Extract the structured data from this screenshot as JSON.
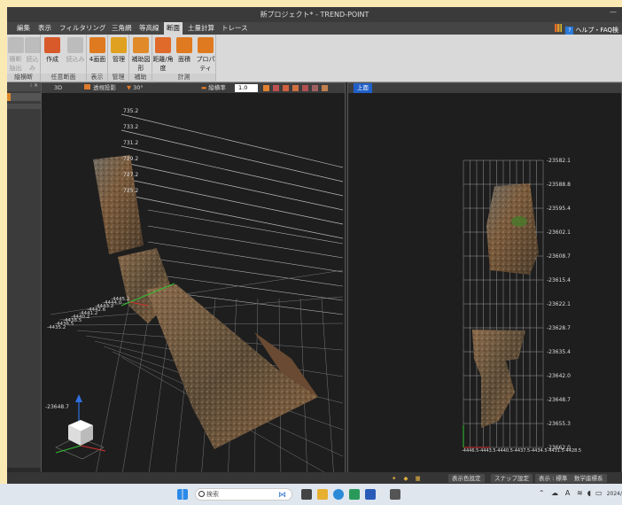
{
  "window": {
    "title": "新プロジェクト* - TREND-POINT"
  },
  "menu": {
    "tabs": [
      "編集",
      "表示",
      "フィルタリング",
      "三角網",
      "等高線",
      "断面",
      "土量計算",
      "トレース"
    ],
    "active": "断面",
    "help_label": "ヘルプ・FAQ検"
  },
  "ribbon": {
    "groups": [
      {
        "label": "縦横断",
        "buttons": [
          {
            "label": "横断抽出",
            "disabled": true
          },
          {
            "label": "読込み",
            "disabled": true
          }
        ]
      },
      {
        "label": "任意断面",
        "buttons": [
          {
            "label": "作成",
            "disabled": false
          },
          {
            "label": "読込み",
            "disabled": true
          }
        ]
      },
      {
        "label": "表示",
        "buttons": [
          {
            "label": "4画面",
            "disabled": false
          }
        ]
      },
      {
        "label": "管理",
        "buttons": [
          {
            "label": "管理",
            "disabled": false
          }
        ]
      },
      {
        "label": "補助",
        "buttons": [
          {
            "label": "補助図形",
            "disabled": false
          }
        ]
      },
      {
        "label": "計測",
        "buttons": [
          {
            "label": "距離/角度",
            "disabled": false
          },
          {
            "label": "面積",
            "disabled": false
          },
          {
            "label": "プロパティ",
            "disabled": false
          }
        ]
      }
    ]
  },
  "view3d": {
    "tab": "3D",
    "mode_label": "透視投影",
    "angle_label": "30°",
    "scale_label": "縦横率",
    "scale_value": "1.0",
    "height_labels": [
      "735.2",
      "733.2",
      "731.2",
      "729.2",
      "727.2",
      "725.2"
    ],
    "x_labels": [
      "-4435.2",
      "-4436.5",
      "-4438.5",
      "-4440.2",
      "-4441.2",
      "-4442.6",
      "-4443.2",
      "-4444.0",
      "-4445.2"
    ],
    "y_label": "-23648.7"
  },
  "viewtop": {
    "tab": "上面",
    "y_labels": [
      "-23582.1",
      "-23588.8",
      "-23595.4",
      "-23602.1",
      "-23608.7",
      "-23615.4",
      "-23622.1",
      "-23628.7",
      "-23635.4",
      "-23642.0",
      "-23648.7",
      "-23655.3",
      "-23662.0"
    ],
    "x_labels_text": "-4446.5-4443.5-4440.5-4437.5-4434.5-4431.5-4428.5"
  },
  "statusbar": {
    "items": [
      "表示色設定",
      "スナップ設定",
      "表示 : 標準",
      "数学座標系"
    ]
  },
  "taskbar": {
    "search_placeholder": "検索",
    "clock": "2024/"
  }
}
